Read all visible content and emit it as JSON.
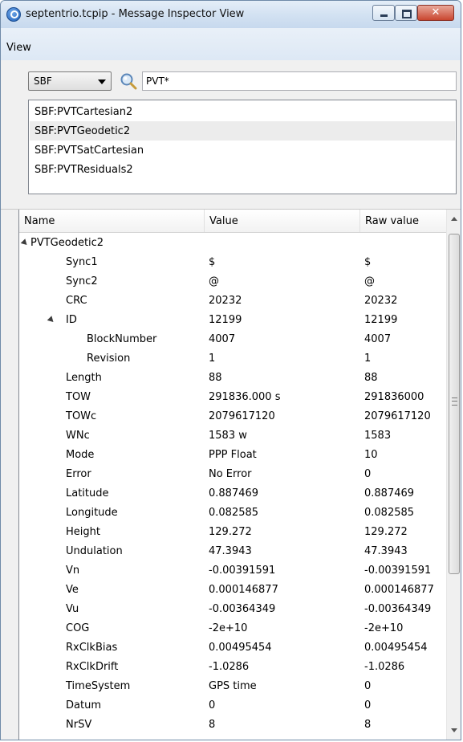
{
  "window": {
    "title": "septentrio.tcpip - Message Inspector View"
  },
  "menu": {
    "view": "View"
  },
  "filter": {
    "format": "SBF",
    "query": "PVT*"
  },
  "messages": [
    {
      "label": "SBF:PVTCartesian2",
      "selected": false
    },
    {
      "label": "SBF:PVTGeodetic2",
      "selected": true
    },
    {
      "label": "SBF:PVTSatCartesian",
      "selected": false
    },
    {
      "label": "SBF:PVTResiduals2",
      "selected": false
    }
  ],
  "columns": {
    "name": "Name",
    "value": "Value",
    "raw": "Raw value"
  },
  "tree_rows": [
    {
      "name": "PVTGeodetic2",
      "value": "",
      "raw": "",
      "level": 0,
      "expander": true
    },
    {
      "name": "Sync1",
      "value": "$",
      "raw": "$",
      "level": 1
    },
    {
      "name": "Sync2",
      "value": "@",
      "raw": "@",
      "level": 1
    },
    {
      "name": "CRC",
      "value": "20232",
      "raw": "20232",
      "level": 1
    },
    {
      "name": "ID",
      "value": "12199",
      "raw": "12199",
      "level": 1,
      "expander": true
    },
    {
      "name": "BlockNumber",
      "value": "4007",
      "raw": "4007",
      "level": 2
    },
    {
      "name": "Revision",
      "value": "1",
      "raw": "1",
      "level": 2
    },
    {
      "name": "Length",
      "value": "88",
      "raw": "88",
      "level": 1
    },
    {
      "name": "TOW",
      "value": "291836.000 s",
      "raw": "291836000",
      "level": 1
    },
    {
      "name": "TOWc",
      "value": "2079617120",
      "raw": "2079617120",
      "level": 1
    },
    {
      "name": "WNc",
      "value": "1583 w",
      "raw": "1583",
      "level": 1
    },
    {
      "name": "Mode",
      "value": "PPP Float",
      "raw": "10",
      "level": 1
    },
    {
      "name": "Error",
      "value": "No Error",
      "raw": "0",
      "level": 1
    },
    {
      "name": "Latitude",
      "value": "0.887469",
      "raw": "0.887469",
      "level": 1
    },
    {
      "name": "Longitude",
      "value": "0.082585",
      "raw": "0.082585",
      "level": 1
    },
    {
      "name": "Height",
      "value": "129.272",
      "raw": "129.272",
      "level": 1
    },
    {
      "name": "Undulation",
      "value": "47.3943",
      "raw": "47.3943",
      "level": 1
    },
    {
      "name": "Vn",
      "value": "-0.00391591",
      "raw": "-0.00391591",
      "level": 1
    },
    {
      "name": "Ve",
      "value": "0.000146877",
      "raw": "0.000146877",
      "level": 1
    },
    {
      "name": "Vu",
      "value": "-0.00364349",
      "raw": "-0.00364349",
      "level": 1
    },
    {
      "name": "COG",
      "value": "-2e+10",
      "raw": "-2e+10",
      "level": 1
    },
    {
      "name": "RxClkBias",
      "value": "0.00495454",
      "raw": "0.00495454",
      "level": 1
    },
    {
      "name": "RxClkDrift",
      "value": "-1.0286",
      "raw": "-1.0286",
      "level": 1
    },
    {
      "name": "TimeSystem",
      "value": "GPS time",
      "raw": "0",
      "level": 1
    },
    {
      "name": "Datum",
      "value": "0",
      "raw": "0",
      "level": 1
    },
    {
      "name": "NrSV",
      "value": "8",
      "raw": "8",
      "level": 1
    }
  ],
  "colors": {
    "selection": "#ececec",
    "window_frame": "#cfdff0",
    "close_button": "#c9462f"
  },
  "icons": {
    "app": "inspector-icon",
    "search": "search-icon"
  }
}
